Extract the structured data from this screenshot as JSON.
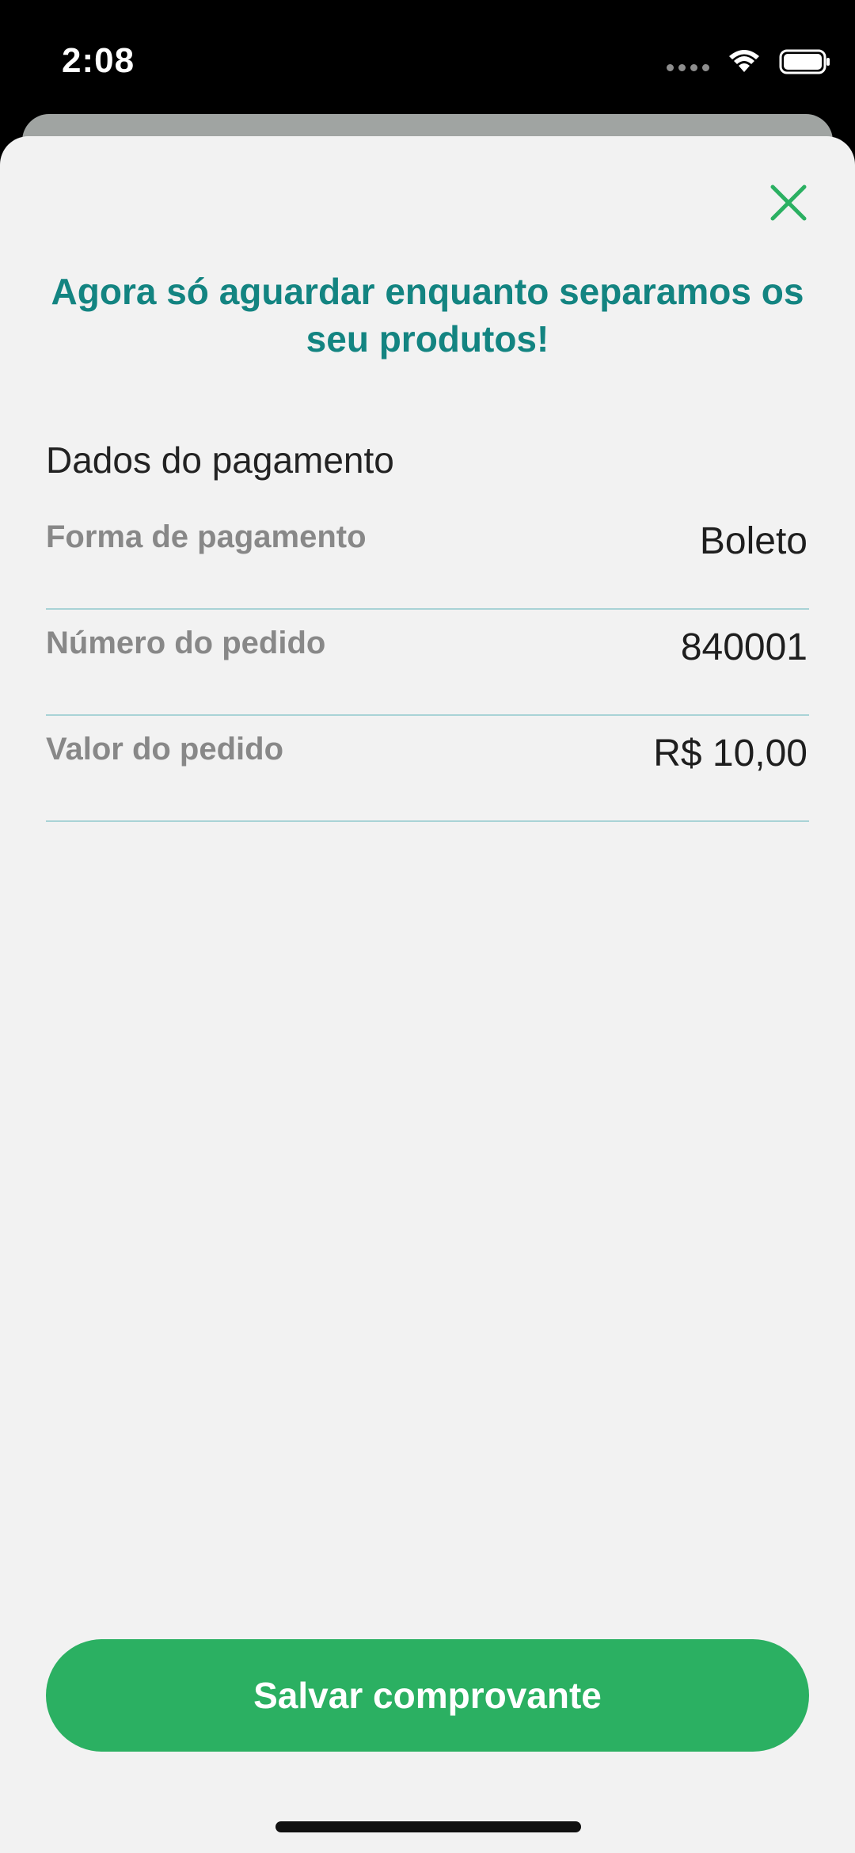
{
  "status_bar": {
    "time": "2:08",
    "icons": [
      "cellular-signal-icon",
      "wifi-icon",
      "battery-icon"
    ]
  },
  "modal": {
    "close_icon": "close-icon",
    "headline": "Agora só aguardar enquanto separamos os seu produtos!",
    "section_title": "Dados do pagamento",
    "rows": [
      {
        "label": "Forma de pagamento",
        "value": "Boleto"
      },
      {
        "label": "Número do pedido",
        "value": "840001"
      },
      {
        "label": "Valor do pedido",
        "value": "R$ 10,00"
      }
    ],
    "save_button_label": "Salvar comprovante"
  },
  "colors": {
    "accent_green": "#2bb062",
    "headline_teal": "#138481",
    "divider": "#a9d3d6",
    "sheet_background": "#f2f2f2"
  }
}
